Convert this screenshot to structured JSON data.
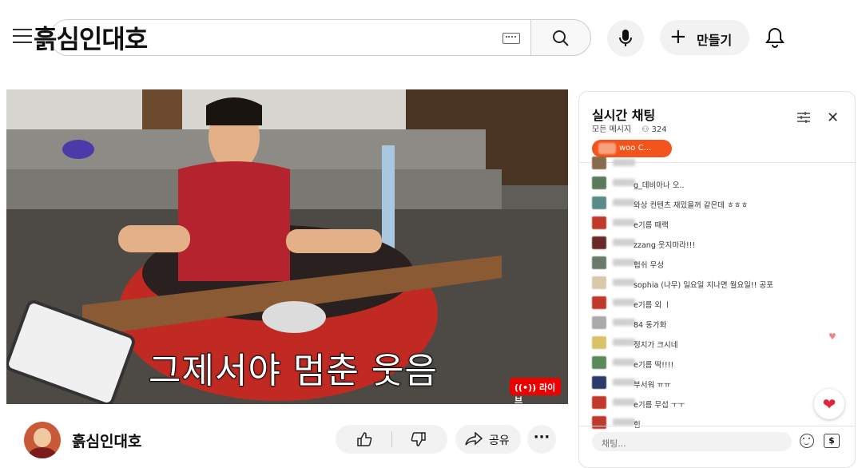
{
  "header": {
    "logo_text": "흙심인대호",
    "search_placeholder": "",
    "create_label": "만들기"
  },
  "player": {
    "subtitle": "그제서야 멈춘 웃음",
    "live_label": "((•)) 라이브"
  },
  "channel": {
    "name": "흙심인대호",
    "share_label": "공유",
    "more_label": "···"
  },
  "chat": {
    "title": "실시간 채팅",
    "filter_label": "모든 메시지",
    "viewer_count": "324",
    "pinned_label": "woo C...",
    "input_placeholder": "채팅...",
    "messages": [
      {
        "text": "",
        "color": "#8a6a4a"
      },
      {
        "text": "g_데비아나  오..",
        "color": "#5a7a5a"
      },
      {
        "text": "와상 컨텐츠 재밌을꺼 같은데 ㅎㅎㅎ",
        "color": "#5a8a8a"
      },
      {
        "text": "e기름   때랙",
        "color": "#c0392b"
      },
      {
        "text": "zzang   웃지마라!!!",
        "color": "#6a2a2a"
      },
      {
        "text": "험쉬 무성",
        "color": "#6a7a6a"
      },
      {
        "text": "sophia (나무)   일요일 지나면 월요일!! 공포",
        "color": "#d9c9a9"
      },
      {
        "text": "e기름   외 ㅣ",
        "color": "#c0392b"
      },
      {
        "text": "84 동가화",
        "color": "#aaaaaa"
      },
      {
        "text": "정지가 크시네",
        "color": "#d9c36a"
      },
      {
        "text": "e기름   딱!!!!",
        "color": "#5a8a5a"
      },
      {
        "text": "부서워 ㅠㅠ",
        "color": "#2a3a6a"
      },
      {
        "text": "e기름   무섭 ㅜㅜ",
        "color": "#c0392b"
      },
      {
        "text": "힘",
        "color": "#c0392b"
      }
    ]
  },
  "colors": {
    "live_red": "#ee0000",
    "pinned_orange": "#f2541b",
    "heart_red": "#e0263a"
  }
}
